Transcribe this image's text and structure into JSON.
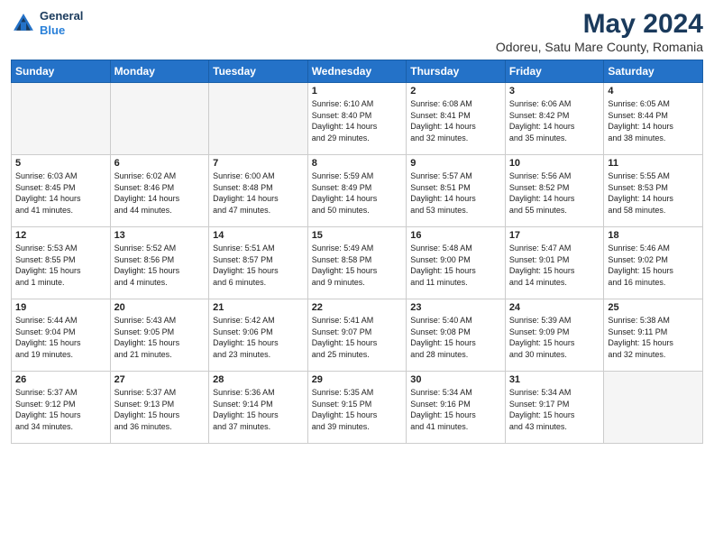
{
  "header": {
    "logo_line1": "General",
    "logo_line2": "Blue",
    "title": "May 2024",
    "location": "Odoreu, Satu Mare County, Romania"
  },
  "weekdays": [
    "Sunday",
    "Monday",
    "Tuesday",
    "Wednesday",
    "Thursday",
    "Friday",
    "Saturday"
  ],
  "weeks": [
    [
      {
        "day": "",
        "info": ""
      },
      {
        "day": "",
        "info": ""
      },
      {
        "day": "",
        "info": ""
      },
      {
        "day": "1",
        "info": "Sunrise: 6:10 AM\nSunset: 8:40 PM\nDaylight: 14 hours\nand 29 minutes."
      },
      {
        "day": "2",
        "info": "Sunrise: 6:08 AM\nSunset: 8:41 PM\nDaylight: 14 hours\nand 32 minutes."
      },
      {
        "day": "3",
        "info": "Sunrise: 6:06 AM\nSunset: 8:42 PM\nDaylight: 14 hours\nand 35 minutes."
      },
      {
        "day": "4",
        "info": "Sunrise: 6:05 AM\nSunset: 8:44 PM\nDaylight: 14 hours\nand 38 minutes."
      }
    ],
    [
      {
        "day": "5",
        "info": "Sunrise: 6:03 AM\nSunset: 8:45 PM\nDaylight: 14 hours\nand 41 minutes."
      },
      {
        "day": "6",
        "info": "Sunrise: 6:02 AM\nSunset: 8:46 PM\nDaylight: 14 hours\nand 44 minutes."
      },
      {
        "day": "7",
        "info": "Sunrise: 6:00 AM\nSunset: 8:48 PM\nDaylight: 14 hours\nand 47 minutes."
      },
      {
        "day": "8",
        "info": "Sunrise: 5:59 AM\nSunset: 8:49 PM\nDaylight: 14 hours\nand 50 minutes."
      },
      {
        "day": "9",
        "info": "Sunrise: 5:57 AM\nSunset: 8:51 PM\nDaylight: 14 hours\nand 53 minutes."
      },
      {
        "day": "10",
        "info": "Sunrise: 5:56 AM\nSunset: 8:52 PM\nDaylight: 14 hours\nand 55 minutes."
      },
      {
        "day": "11",
        "info": "Sunrise: 5:55 AM\nSunset: 8:53 PM\nDaylight: 14 hours\nand 58 minutes."
      }
    ],
    [
      {
        "day": "12",
        "info": "Sunrise: 5:53 AM\nSunset: 8:55 PM\nDaylight: 15 hours\nand 1 minute."
      },
      {
        "day": "13",
        "info": "Sunrise: 5:52 AM\nSunset: 8:56 PM\nDaylight: 15 hours\nand 4 minutes."
      },
      {
        "day": "14",
        "info": "Sunrise: 5:51 AM\nSunset: 8:57 PM\nDaylight: 15 hours\nand 6 minutes."
      },
      {
        "day": "15",
        "info": "Sunrise: 5:49 AM\nSunset: 8:58 PM\nDaylight: 15 hours\nand 9 minutes."
      },
      {
        "day": "16",
        "info": "Sunrise: 5:48 AM\nSunset: 9:00 PM\nDaylight: 15 hours\nand 11 minutes."
      },
      {
        "day": "17",
        "info": "Sunrise: 5:47 AM\nSunset: 9:01 PM\nDaylight: 15 hours\nand 14 minutes."
      },
      {
        "day": "18",
        "info": "Sunrise: 5:46 AM\nSunset: 9:02 PM\nDaylight: 15 hours\nand 16 minutes."
      }
    ],
    [
      {
        "day": "19",
        "info": "Sunrise: 5:44 AM\nSunset: 9:04 PM\nDaylight: 15 hours\nand 19 minutes."
      },
      {
        "day": "20",
        "info": "Sunrise: 5:43 AM\nSunset: 9:05 PM\nDaylight: 15 hours\nand 21 minutes."
      },
      {
        "day": "21",
        "info": "Sunrise: 5:42 AM\nSunset: 9:06 PM\nDaylight: 15 hours\nand 23 minutes."
      },
      {
        "day": "22",
        "info": "Sunrise: 5:41 AM\nSunset: 9:07 PM\nDaylight: 15 hours\nand 25 minutes."
      },
      {
        "day": "23",
        "info": "Sunrise: 5:40 AM\nSunset: 9:08 PM\nDaylight: 15 hours\nand 28 minutes."
      },
      {
        "day": "24",
        "info": "Sunrise: 5:39 AM\nSunset: 9:09 PM\nDaylight: 15 hours\nand 30 minutes."
      },
      {
        "day": "25",
        "info": "Sunrise: 5:38 AM\nSunset: 9:11 PM\nDaylight: 15 hours\nand 32 minutes."
      }
    ],
    [
      {
        "day": "26",
        "info": "Sunrise: 5:37 AM\nSunset: 9:12 PM\nDaylight: 15 hours\nand 34 minutes."
      },
      {
        "day": "27",
        "info": "Sunrise: 5:37 AM\nSunset: 9:13 PM\nDaylight: 15 hours\nand 36 minutes."
      },
      {
        "day": "28",
        "info": "Sunrise: 5:36 AM\nSunset: 9:14 PM\nDaylight: 15 hours\nand 37 minutes."
      },
      {
        "day": "29",
        "info": "Sunrise: 5:35 AM\nSunset: 9:15 PM\nDaylight: 15 hours\nand 39 minutes."
      },
      {
        "day": "30",
        "info": "Sunrise: 5:34 AM\nSunset: 9:16 PM\nDaylight: 15 hours\nand 41 minutes."
      },
      {
        "day": "31",
        "info": "Sunrise: 5:34 AM\nSunset: 9:17 PM\nDaylight: 15 hours\nand 43 minutes."
      },
      {
        "day": "",
        "info": ""
      }
    ]
  ]
}
